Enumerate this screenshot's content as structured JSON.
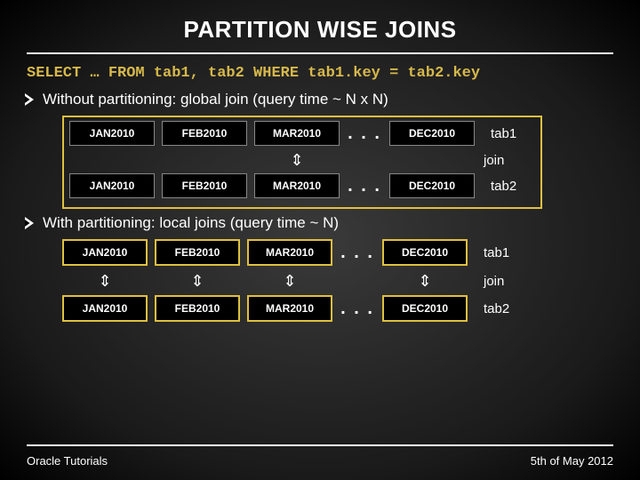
{
  "title": "PARTITION WISE JOINS",
  "sql": "SELECT … FROM tab1, tab2 WHERE tab1.key = tab2.key",
  "bullets": {
    "without": "Without partitioning: global join (query time ~ N x N)",
    "with": "With partitioning: local joins (query time ~ N)"
  },
  "partitions": [
    "JAN2010",
    "FEB2010",
    "MAR2010",
    "DEC2010"
  ],
  "dots": ". . .",
  "labels": {
    "tab1": "tab1",
    "tab2": "tab2",
    "join": "join"
  },
  "join_arrow": "⇕",
  "footer": {
    "left": "Oracle Tutorials",
    "right": "5th of May 2012"
  }
}
